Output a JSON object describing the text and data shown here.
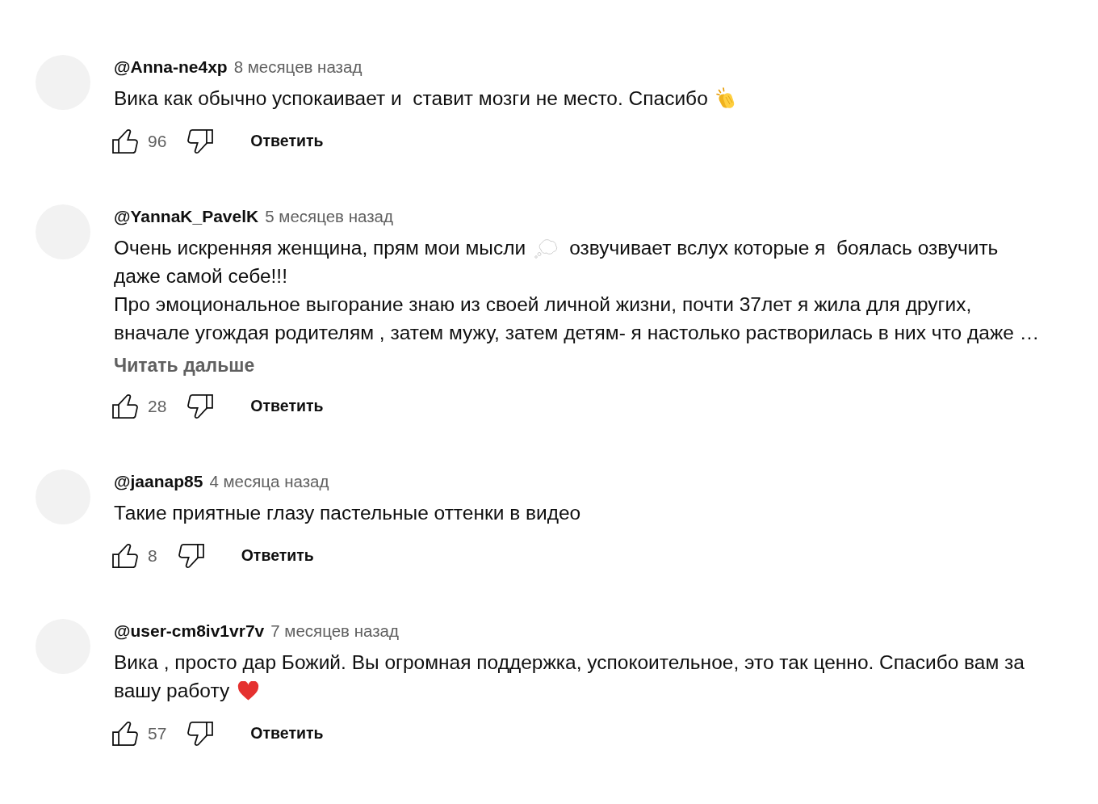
{
  "comments": [
    {
      "author": "@Anna-ne4xp",
      "time": "8 месяцев назад",
      "lines": [
        [
          {
            "kind": "text",
            "text": "Вика как обычно успокаивает и  ставит мозги не место. Спасибо"
          },
          {
            "kind": "clap"
          }
        ]
      ],
      "likes": "96",
      "reply": "Ответить"
    },
    {
      "author": "@YannaK_PavelK",
      "time": "5 месяцев назад",
      "lines": [
        [
          {
            "kind": "text",
            "text": "Очень искренняя женщина, прям мои мысли"
          },
          {
            "kind": "thought"
          },
          {
            "kind": "text",
            "text": "озвучивает вслух которые я  боялась озвучить"
          }
        ],
        [
          {
            "kind": "text",
            "text": "даже самой себе!!!"
          }
        ],
        [
          {
            "kind": "text",
            "text": "Про эмоциональное выгорание знаю из своей личной жизни, почти 37лет я жила для других,"
          }
        ],
        [
          {
            "kind": "text",
            "text": "вначале угождая родителям , затем мужу, затем детям- я настолько растворилась в них что даже …"
          }
        ]
      ],
      "read_more": "Читать дальше",
      "likes": "28",
      "reply": "Ответить"
    },
    {
      "author": "@jaanap85",
      "time": "4 месяца назад",
      "lines": [
        [
          {
            "kind": "text",
            "text": "Такие приятные глазу пастельные оттенки в видео"
          }
        ]
      ],
      "likes": "8",
      "reply": "Ответить"
    },
    {
      "author": "@user-cm8iv1vr7v",
      "time": "7 месяцев назад",
      "lines": [
        [
          {
            "kind": "text",
            "text": "Вика , просто дар Божий. Вы огромная поддержка, успокоительное, это так ценно. Спасибо вам за"
          }
        ],
        [
          {
            "kind": "text",
            "text": "вашу работу"
          },
          {
            "kind": "heart"
          }
        ]
      ],
      "likes": "57",
      "reply": "Ответить"
    }
  ]
}
